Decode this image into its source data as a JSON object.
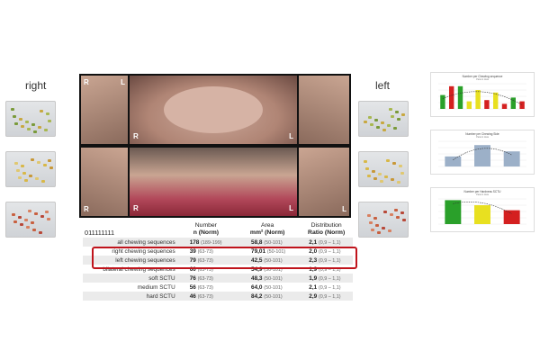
{
  "labels": {
    "right": "right",
    "left": "left"
  },
  "photo_letters": [
    "R",
    "L",
    "R",
    "L",
    "R",
    "L",
    "R",
    "L"
  ],
  "table": {
    "id": "011111111",
    "headers": {
      "number": [
        "Number",
        "n (Norm)"
      ],
      "area": [
        "Area",
        "mm² (Norm)"
      ],
      "distribution": [
        "Distribution",
        "Ratio (Norm)"
      ]
    },
    "rows": [
      {
        "label": "all chewing sequences",
        "n": "178",
        "n_norm": "(189-199)",
        "area": "58,8",
        "area_norm": "(50-101)",
        "ratio": "2,1",
        "ratio_norm": "(0,9 – 1,1)"
      },
      {
        "label": "right chewing sequences",
        "n": "39",
        "n_norm": "(63-73)",
        "area": "79,01",
        "area_norm": "(50-101)",
        "ratio": "2,0",
        "ratio_norm": "(0,9 – 1,1)"
      },
      {
        "label": "left chewing sequences",
        "n": "79",
        "n_norm": "(63-73)",
        "area": "42,5",
        "area_norm": "(50-101)",
        "ratio": "2,3",
        "ratio_norm": "(0,9 – 1,1)"
      },
      {
        "label": "bilateral chewing sequences",
        "n": "60",
        "n_norm": "(63-73)",
        "area": "54,9",
        "area_norm": "(50-101)",
        "ratio": "1,9",
        "ratio_norm": "(0,9 – 1,1)"
      },
      {
        "label": "soft SCTU",
        "n": "76",
        "n_norm": "(63-73)",
        "area": "48,3",
        "area_norm": "(50-101)",
        "ratio": "1,9",
        "ratio_norm": "(0,9 – 1,1)"
      },
      {
        "label": "medium SCTU",
        "n": "56",
        "n_norm": "(63-73)",
        "area": "64,0",
        "area_norm": "(50-101)",
        "ratio": "2,1",
        "ratio_norm": "(0,9 – 1,1)"
      },
      {
        "label": "hard SCTU",
        "n": "46",
        "n_norm": "(63-73)",
        "area": "84,2",
        "area_norm": "(50-101)",
        "ratio": "2,9",
        "ratio_norm": "(0,9 – 1,1)"
      }
    ]
  },
  "charts": [
    {
      "title": "Number per Chewing sequence",
      "subtitle": "Patient data",
      "type": "bar",
      "values": [
        0.55,
        0.9,
        0.9,
        0.3,
        0.75,
        0.35,
        0.65,
        0.2,
        0.45,
        0.3
      ],
      "colors": [
        "#2aa02a",
        "#d42020",
        "#2aa02a",
        "#e8e020",
        "#e8e020",
        "#d42020",
        "#e8e020",
        "#d42020",
        "#2aa02a",
        "#d42020"
      ]
    },
    {
      "title": "Number per Chewing Side",
      "subtitle": "Patient data",
      "type": "bar",
      "values": [
        0.4,
        0.85,
        0.6
      ],
      "colors": [
        "#9cb0c8",
        "#9cb0c8",
        "#9cb0c8"
      ]
    },
    {
      "title": "Number per Hardness SCTU",
      "subtitle": "Patient data",
      "type": "bar",
      "values": [
        0.95,
        0.75,
        0.55
      ],
      "colors": [
        "#2aa02a",
        "#e8e020",
        "#d42020"
      ]
    }
  ]
}
